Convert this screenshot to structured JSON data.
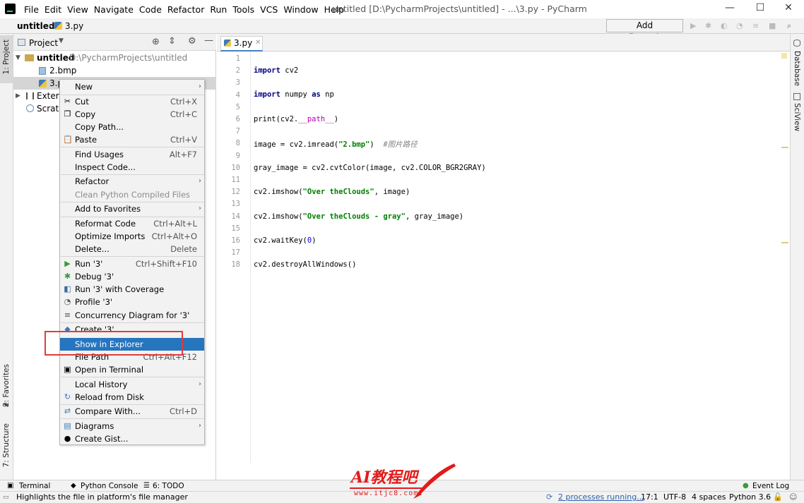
{
  "window": {
    "menu": [
      "File",
      "Edit",
      "View",
      "Navigate",
      "Code",
      "Refactor",
      "Run",
      "Tools",
      "VCS",
      "Window",
      "Help"
    ],
    "title": "untitled [D:\\PycharmProjects\\untitled] - ...\\3.py - PyCharm",
    "controls": {
      "minimize": "—",
      "maximize": "☐",
      "close": "✕"
    }
  },
  "navbar": {
    "project": "untitled",
    "file": "3.py",
    "add_configuration": "Add Configuration..."
  },
  "left_strip": {
    "project": "1: Project",
    "favorites": "2: Favorites",
    "structure": "7: Structure"
  },
  "right_strip": {
    "database": "Database",
    "sciview": "SciView"
  },
  "project_panel": {
    "title": "Project",
    "root_name": "untitled",
    "root_path": "D:\\PycharmProjects\\untitled",
    "items": [
      "2.bmp",
      "3.py",
      "External Libraries",
      "Scratches and Consoles"
    ],
    "visible": {
      "item2": "3.p",
      "item3": "Extern",
      "item4": "Scratc"
    }
  },
  "editor": {
    "tab": "3.py",
    "line_numbers": [
      "1",
      "2",
      "3",
      "4",
      "5",
      "6",
      "7",
      "8",
      "9",
      "10",
      "11",
      "12",
      "13",
      "14",
      "15",
      "16",
      "17",
      "18"
    ],
    "lines": {
      "l2": {
        "kw": "import",
        "rest": " cv2"
      },
      "l4": {
        "kw": "import",
        "mid": " numpy ",
        "kw2": "as",
        "rest": " np"
      },
      "l6": {
        "pre": "print(cv2.",
        "mg": "__path__",
        "post": ")"
      },
      "l8": {
        "pre": "image = cv2.imread(",
        "str": "\"2.bmp\"",
        "post": ")  ",
        "cm": "#图片路径"
      },
      "l10": "gray_image = cv2.cvtColor(image, cv2.COLOR_BGR2GRAY)",
      "l12": {
        "pre": "cv2.imshow(",
        "str": "\"Over theClouds\"",
        "post": ", image)"
      },
      "l14": {
        "pre": "cv2.imshow(",
        "str": "\"Over theClouds - gray\"",
        "post": ", gray_image)"
      },
      "l16": {
        "pre": "cv2.waitKey(",
        "num": "0",
        "post": ")"
      },
      "l18": "cv2.destroyAllWindows()"
    }
  },
  "context_menu": {
    "new": "New",
    "cut": "Cut",
    "cut_sc": "Ctrl+X",
    "copy": "Copy",
    "copy_sc": "Ctrl+C",
    "copy_path": "Copy Path...",
    "paste": "Paste",
    "paste_sc": "Ctrl+V",
    "find_usages": "Find Usages",
    "find_usages_sc": "Alt+F7",
    "inspect_code": "Inspect Code...",
    "refactor": "Refactor",
    "clean_python": "Clean Python Compiled Files",
    "add_favorites": "Add to Favorites",
    "reformat": "Reformat Code",
    "reformat_sc": "Ctrl+Alt+L",
    "optimize": "Optimize Imports",
    "optimize_sc": "Ctrl+Alt+O",
    "delete": "Delete...",
    "delete_sc": "Delete",
    "run": "Run '3'",
    "run_sc": "Ctrl+Shift+F10",
    "debug": "Debug '3'",
    "coverage": "Run '3' with Coverage",
    "profile": "Profile '3'",
    "concurrency": "Concurrency Diagram for '3'",
    "create": "Create '3'...",
    "show_explorer": "Show in Explorer",
    "file_path": "File Path",
    "file_path_sc": "Ctrl+Alt+F12",
    "open_terminal": "Open in Terminal",
    "local_history": "Local History",
    "reload": "Reload from Disk",
    "compare": "Compare With...",
    "compare_sc": "Ctrl+D",
    "diagrams": "Diagrams",
    "gist": "Create Gist..."
  },
  "bottom_tabs": {
    "terminal": "Terminal",
    "python_console": "Python Console",
    "todo": "6: TODO",
    "event_log": "Event Log"
  },
  "status": {
    "message": "Highlights the file in platform's file manager",
    "processes": "2 processes running...",
    "position": "17:1",
    "encoding": "UTF-8",
    "indent": "4 spaces",
    "interpreter": "Python 3.6"
  },
  "watermark": {
    "text": "AI教程吧",
    "url": "www.itjc8.com"
  },
  "colors": {
    "accent": "#2675bf",
    "highlight_box": "#e33b3b",
    "keyword": "#000080",
    "string": "#008000"
  }
}
